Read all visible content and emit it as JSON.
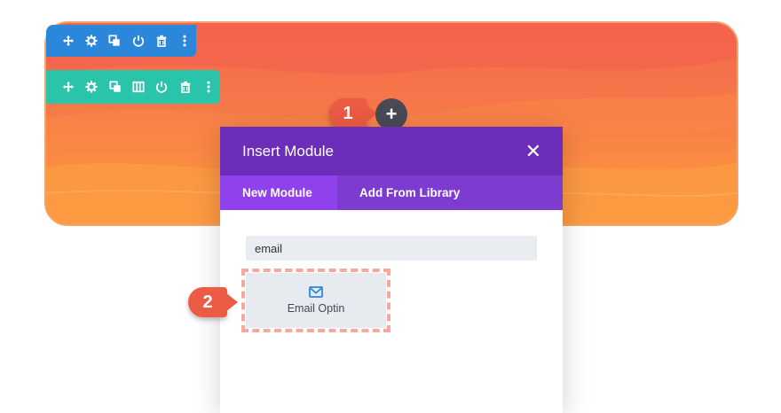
{
  "annotations": {
    "marker_1": "1",
    "marker_2": "2"
  },
  "add_button": {
    "label": "+"
  },
  "section_toolbar": [
    "move-icon",
    "gear-icon",
    "duplicate-icon",
    "power-icon",
    "trash-icon",
    "more-icon"
  ],
  "row_toolbar": [
    "move-icon",
    "gear-icon",
    "duplicate-icon",
    "columns-icon",
    "power-icon",
    "trash-icon",
    "more-icon"
  ],
  "modal": {
    "title": "Insert Module",
    "close_label": "✕",
    "tabs": [
      {
        "label": "New Module",
        "active": true
      },
      {
        "label": "Add From Library",
        "active": false
      }
    ],
    "search": {
      "value": "email",
      "placeholder": ""
    },
    "results": [
      {
        "label": "Email Optin",
        "icon": "envelope-icon"
      }
    ]
  },
  "colors": {
    "section_toolbar": "#2b87da",
    "row_toolbar": "#29c4a9",
    "modal_header": "#6c2eb9",
    "tab_bar": "#7e3bd0",
    "tab_active": "#8f42ec",
    "marker": "#ec5b44"
  }
}
